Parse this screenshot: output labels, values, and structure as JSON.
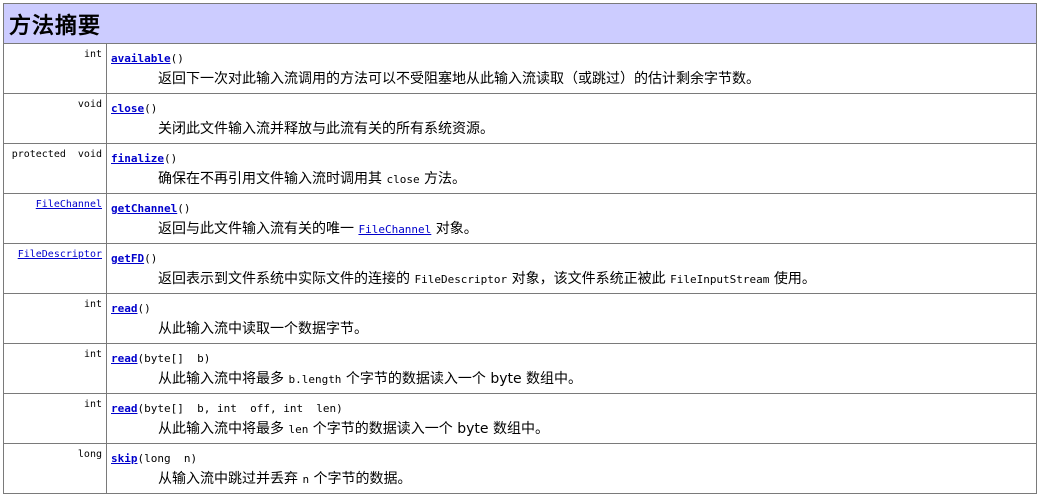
{
  "header": {
    "title": "方法摘要"
  },
  "rows": [
    {
      "type": "int",
      "method": "available",
      "params": "()",
      "desc": "返回下一次对此输入流调用的方法可以不受阻塞地从此输入流读取（或跳过）的估计剩余字节数。"
    },
    {
      "type": "void",
      "method": "close",
      "params": "()",
      "desc": "关闭此文件输入流并释放与此流有关的所有系统资源。"
    },
    {
      "type": "protected  void",
      "method": "finalize",
      "params": "()",
      "desc_a": "确保在不再引用文件输入流时调用其 ",
      "desc_code": "close",
      "desc_b": " 方法。"
    },
    {
      "type": "FileChannel",
      "method": "getChannel",
      "params": "()",
      "desc_a": "返回与此文件输入流有关的唯一 ",
      "desc_link": "FileChannel",
      "desc_b": " 对象。"
    },
    {
      "type": "FileDescriptor",
      "method": "getFD",
      "params": "()",
      "desc_a": "返回表示到文件系统中实际文件的连接的 ",
      "desc_code": "FileDescriptor",
      "desc_b": " 对象，该文件系统正被此 ",
      "desc_code2": "FileInputStream",
      "desc_c": " 使用。"
    },
    {
      "type": "int",
      "method": "read",
      "params": "()",
      "desc": "从此输入流中读取一个数据字节。"
    },
    {
      "type": "int",
      "method": "read",
      "params": "(byte[]  b)",
      "desc_a": "从此输入流中将最多 ",
      "desc_code": "b.length",
      "desc_b": " 个字节的数据读入一个 byte 数组中。"
    },
    {
      "type": "int",
      "method": "read",
      "params": "(byte[]  b, int  off, int  len)",
      "desc_a": "从此输入流中将最多 ",
      "desc_code": "len",
      "desc_b": " 个字节的数据读入一个 byte 数组中。"
    },
    {
      "type": "long",
      "method": "skip",
      "params": "(long  n)",
      "desc_a": "从输入流中跳过并丢弃 ",
      "desc_code": "n",
      "desc_b": " 个字节的数据。"
    }
  ]
}
